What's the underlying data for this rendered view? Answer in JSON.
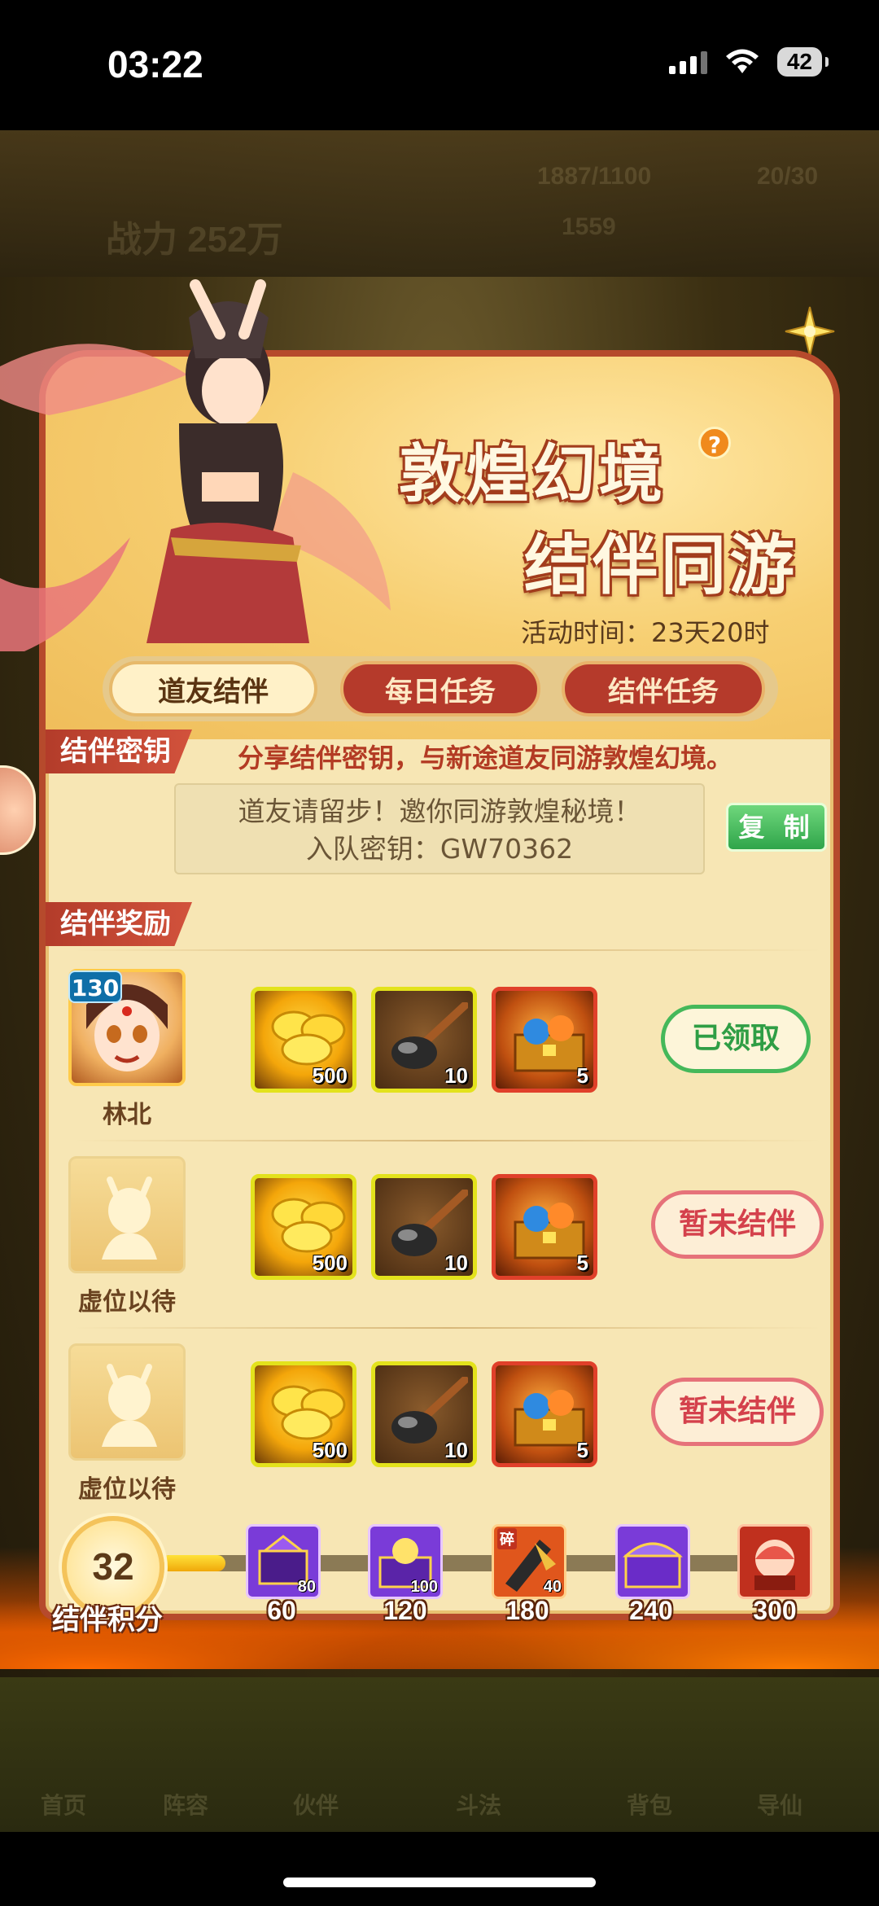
{
  "status": {
    "time": "03:22",
    "battery": "42"
  },
  "background": {
    "ghost_power": "战力 252万",
    "ghost_values": [
      "1887/1100",
      "1559",
      "20/30"
    ],
    "nav": [
      "首页",
      "阵容",
      "伙伴",
      "斗法",
      "背包",
      "导仙"
    ]
  },
  "event": {
    "title_line1": "敦煌幻境",
    "title_line2": "结伴同游",
    "help": "?",
    "time_label": "活动时间：",
    "time_value": "23天20时"
  },
  "tabs": [
    {
      "label": "道友结伴",
      "active": true
    },
    {
      "label": "每日任务",
      "active": false
    },
    {
      "label": "结伴任务",
      "active": false
    }
  ],
  "key_section": {
    "tag": "结伴密钥",
    "note": "分享结伴密钥，与新途道友同游敦煌幻境。",
    "invite_text": "道友请留步！邀你同游敦煌秘境！",
    "key_label": "入队密钥：",
    "key_value": "GW70362",
    "copy_label": "复 制"
  },
  "reward_section": {
    "tag": "结伴奖励",
    "rows": [
      {
        "name": "林北",
        "level": "130",
        "filled": true,
        "items": [
          "500",
          "10",
          "5"
        ],
        "button": "已领取",
        "state": "claimed"
      },
      {
        "name": "虚位以待",
        "filled": false,
        "items": [
          "500",
          "10",
          "5"
        ],
        "button": "暂未结伴",
        "state": "unbound"
      },
      {
        "name": "虚位以待",
        "filled": false,
        "items": [
          "500",
          "10",
          "5"
        ],
        "button": "暂未结伴",
        "state": "unbound"
      }
    ]
  },
  "progress": {
    "score": "32",
    "score_label": "结伴积分",
    "fraction": 0.1,
    "milestones": [
      {
        "value": "60",
        "count": "80",
        "color": "#7a3bd8"
      },
      {
        "value": "120",
        "count": "100",
        "color": "#7a3bd8"
      },
      {
        "value": "180",
        "count": "40",
        "color": "#e0561c",
        "badge": "碎"
      },
      {
        "value": "240",
        "count": "",
        "color": "#7a3bd8"
      },
      {
        "value": "300",
        "count": "",
        "color": "#c0301e"
      }
    ]
  }
}
